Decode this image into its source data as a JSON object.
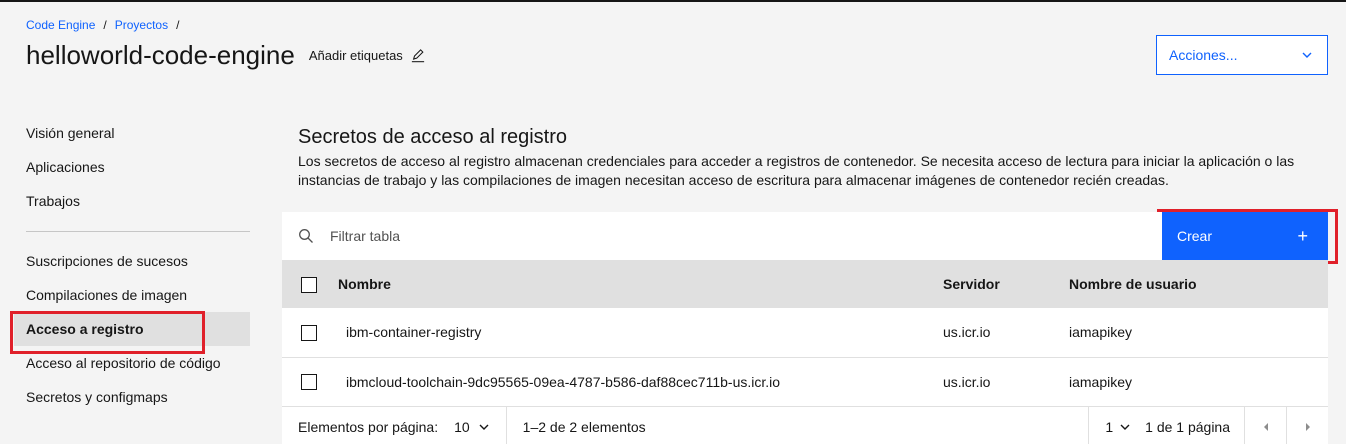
{
  "breadcrumb": {
    "items": [
      "Code Engine",
      "Proyectos"
    ],
    "separator": "/"
  },
  "header": {
    "title": "helloworld-code-engine",
    "add_tags_label": "Añadir etiquetas",
    "actions_label": "Acciones..."
  },
  "sidebar": {
    "group1": [
      "Visión general",
      "Aplicaciones",
      "Trabajos"
    ],
    "group2": [
      "Suscripciones de sucesos",
      "Compilaciones de imagen",
      "Acceso a registro",
      "Acceso al repositorio de código",
      "Secretos y configmaps"
    ],
    "active_item": "Acceso a registro"
  },
  "main": {
    "section_title": "Secretos de acceso al registro",
    "section_description": "Los secretos de acceso al registro almacenan credenciales para acceder a registros de contenedor. Se necesita acceso de lectura para iniciar la aplicación o las instancias de trabajo y las compilaciones de imagen necesitan acceso de escritura para almacenar imágenes de contenedor recién creadas.",
    "filter_placeholder": "Filtrar tabla",
    "create_label": "Crear",
    "table": {
      "headers": [
        "Nombre",
        "Servidor",
        "Nombre de usuario"
      ],
      "rows": [
        [
          "ibm-container-registry",
          "us.icr.io",
          "iamapikey"
        ],
        [
          "ibmcloud-toolchain-9dc95565-09ea-4787-b586-daf88cec711b-us.icr.io",
          "us.icr.io",
          "iamapikey"
        ]
      ]
    },
    "pagination": {
      "per_page_label": "Elementos por página:",
      "per_page_value": "10",
      "range_text": "1–2 de 2 elementos",
      "page_value": "1",
      "page_of_text": "1 de 1 página"
    }
  },
  "colors": {
    "accent": "#0f62fe",
    "highlight": "#e0202a"
  }
}
